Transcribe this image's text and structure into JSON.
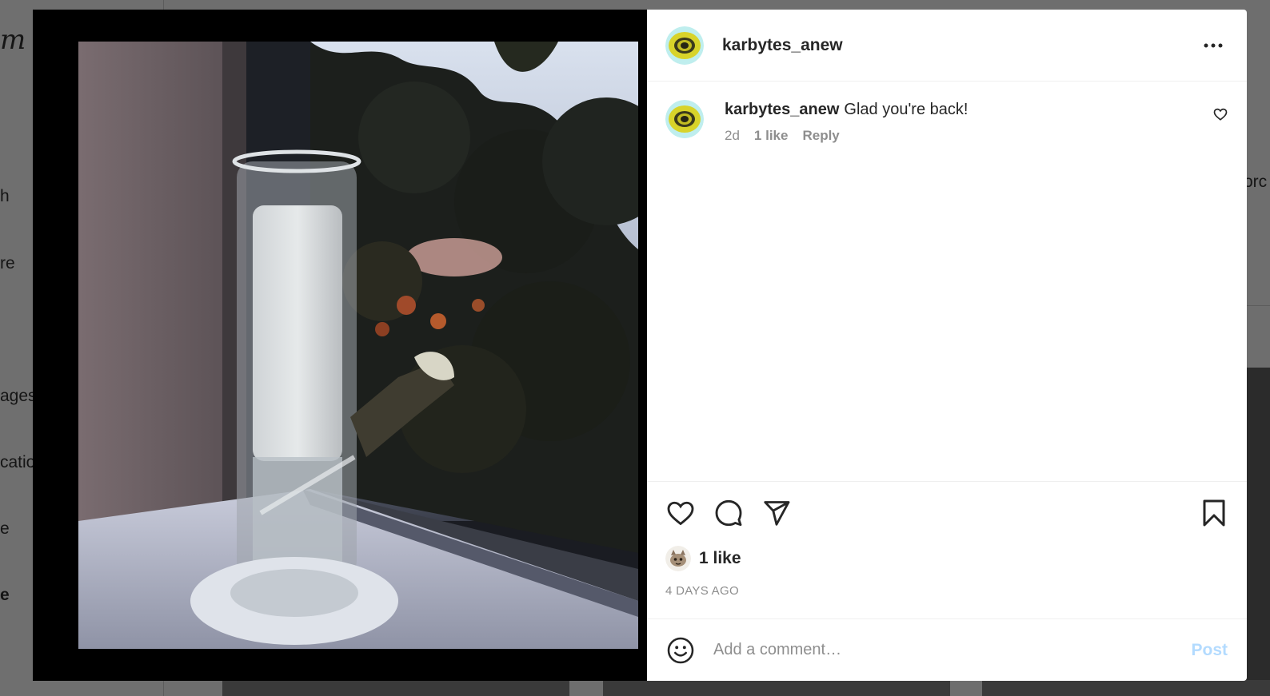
{
  "background": {
    "logo_fragment": "m",
    "nav_fragments": [
      "h",
      "re",
      "ages",
      "catio",
      "e",
      "e"
    ],
    "right_fragment": "orc"
  },
  "post": {
    "username": "karbytes_anew",
    "more_icon": "more-horizontal-icon",
    "comments": [
      {
        "username": "karbytes_anew",
        "text": "Glad you're back!",
        "age": "2d",
        "likes": "1 like",
        "reply_label": "Reply"
      }
    ],
    "likes_label": "1 like",
    "date": "4 DAYS AGO",
    "icons": [
      "heart-icon",
      "comment-icon",
      "share-icon",
      "bookmark-icon"
    ],
    "add_comment_placeholder": "Add a comment…",
    "post_button": "Post"
  },
  "colors": {
    "text_primary": "#262626",
    "text_secondary": "#8e8e8e",
    "post_button_disabled": "#b3dbff"
  }
}
